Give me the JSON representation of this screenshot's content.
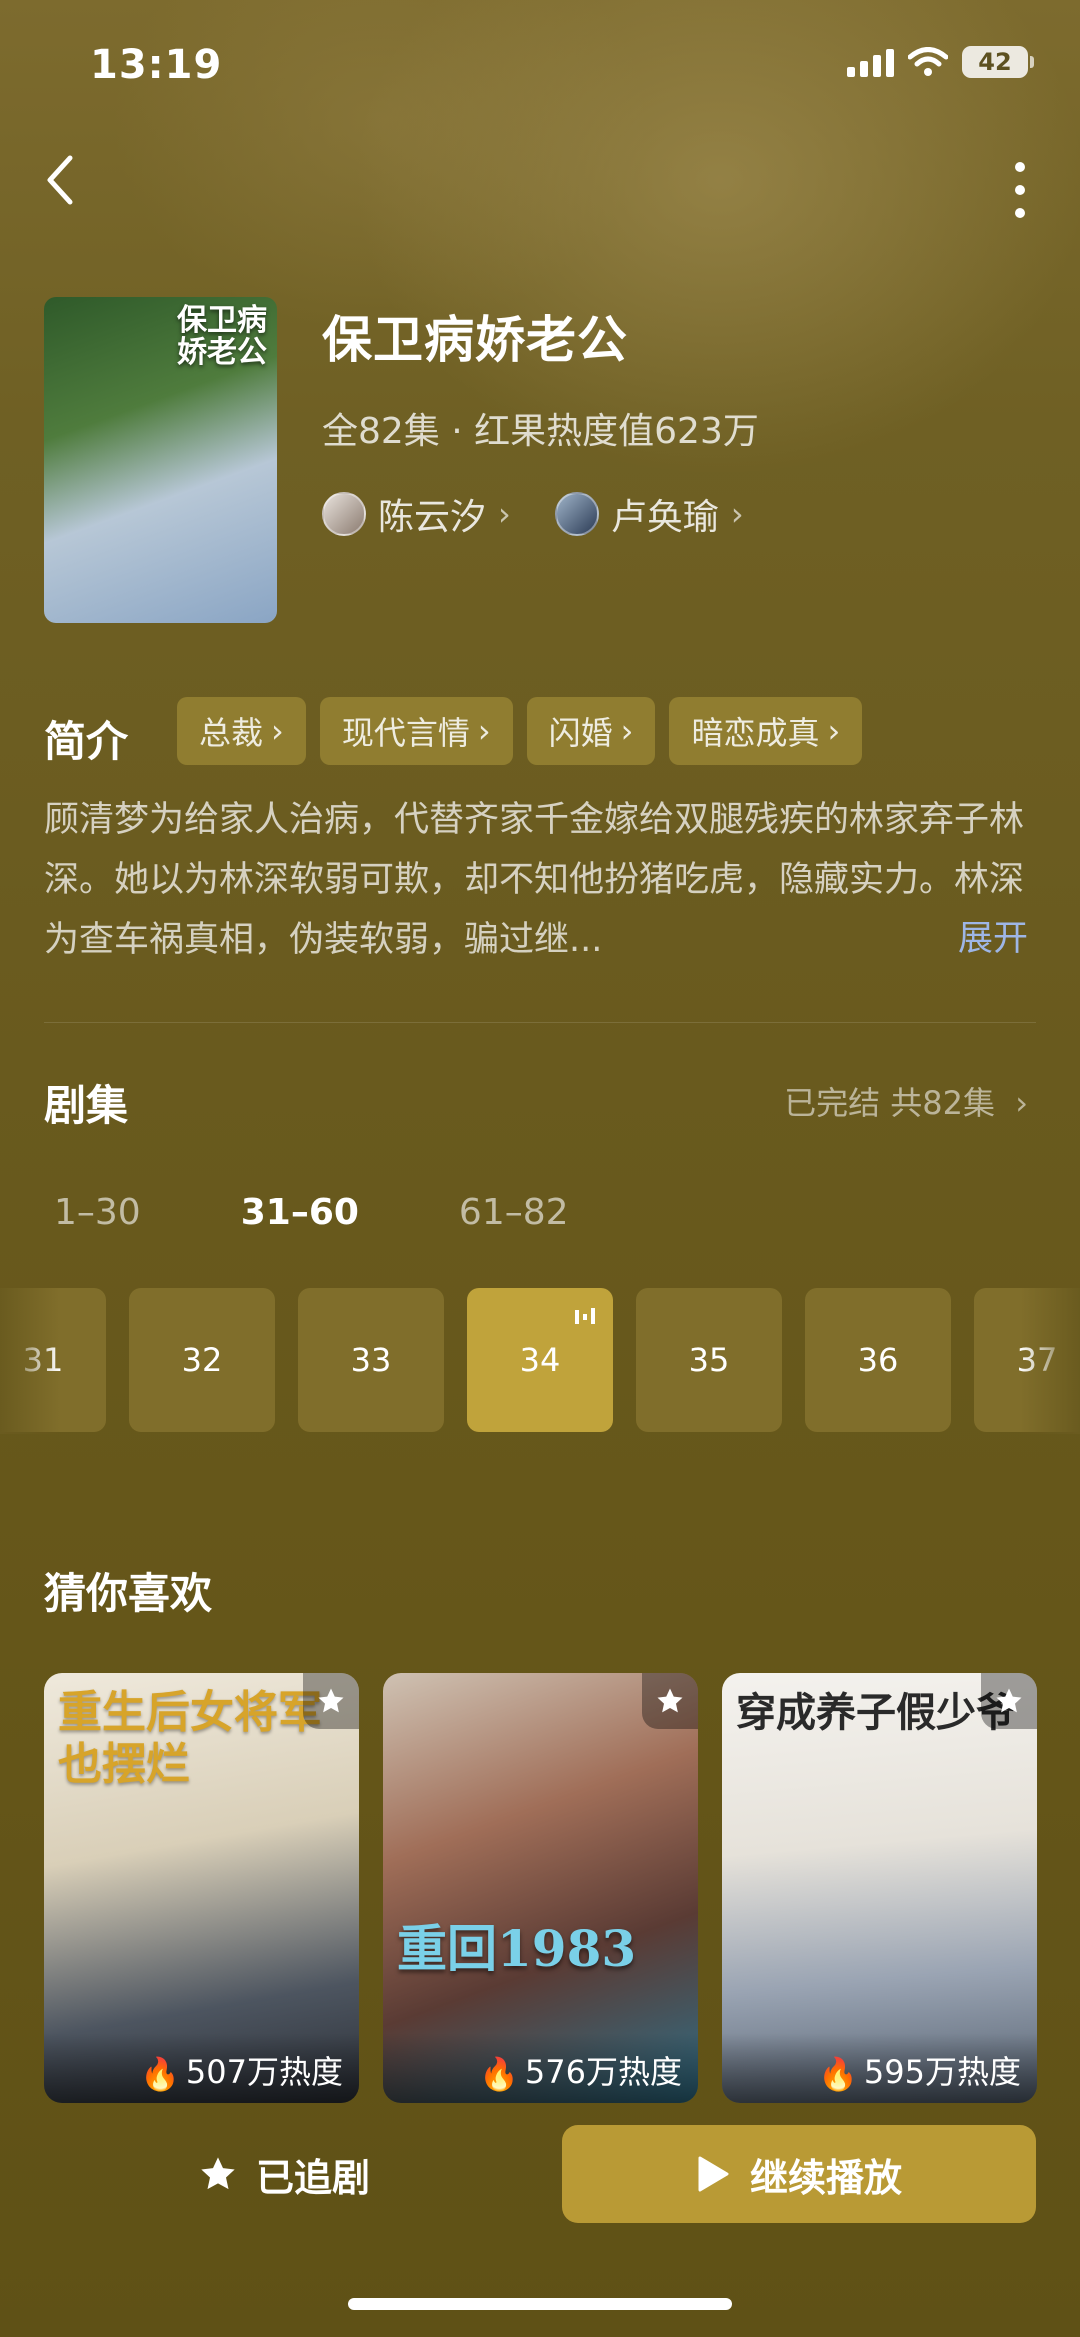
{
  "status_bar": {
    "time": "13:19",
    "battery": "42"
  },
  "drama": {
    "poster_title": "保卫病娇老公",
    "title": "保卫病娇老公",
    "meta": "全82集 · 红果热度值623万",
    "actors": [
      {
        "name": "陈云汐"
      },
      {
        "name": "卢奂瑜"
      }
    ]
  },
  "intro": {
    "heading": "简介",
    "tags": [
      "总裁",
      "现代言情",
      "闪婚",
      "暗恋成真"
    ],
    "description": "顾清梦为给家人治病，代替齐家千金嫁给双腿残疾的林家弃子林深。她以为林深软弱可欺，却不知他扮猪吃虎，隐藏实力。林深为查车祸真相，伪装软弱，骗过继...",
    "expand": "展开"
  },
  "episodes": {
    "heading": "剧集",
    "status": "已完结 共82集",
    "ranges": [
      "1–30",
      "31–60",
      "61–82"
    ],
    "active_range": "31–60",
    "items": [
      "31",
      "32",
      "33",
      "34",
      "35",
      "36",
      "37"
    ],
    "current": "34"
  },
  "recommend": {
    "heading": "猜你喜欢",
    "items": [
      {
        "title": "重生后女将军也摆烂",
        "heat": "507万热度"
      },
      {
        "title": "重回1983",
        "heat": "576万热度"
      },
      {
        "title": "穿成养子假少爷",
        "heat": "595万热度"
      }
    ]
  },
  "bottom": {
    "follow": "已追剧",
    "play": "继续播放"
  },
  "colors": {
    "accent": "#c0a33b",
    "background": "#6b5c1f",
    "link": "#9eb6e6"
  }
}
